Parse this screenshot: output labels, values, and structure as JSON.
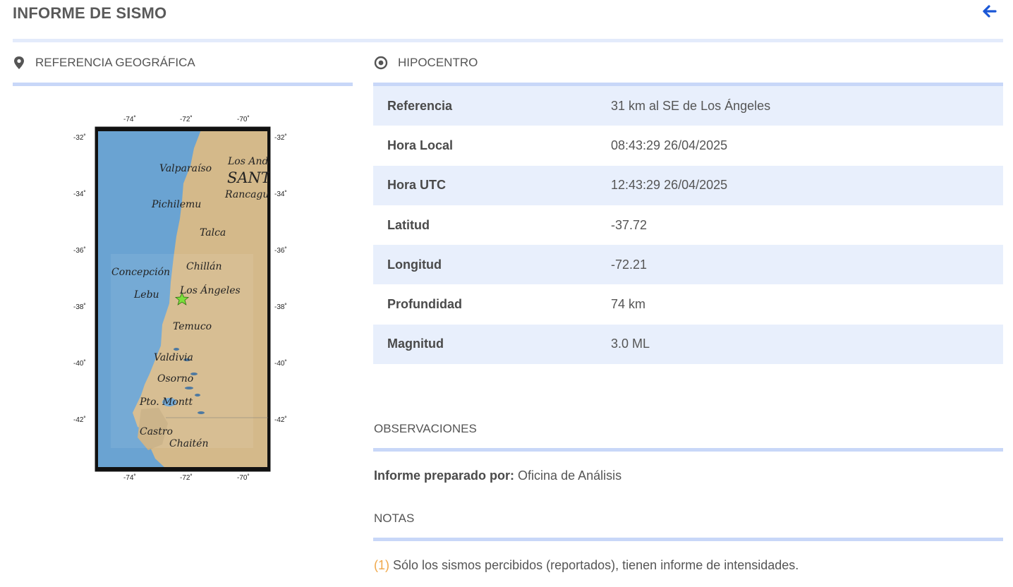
{
  "page": {
    "title": "INFORME DE SISMO",
    "back_icon": "arrow-left-icon",
    "accent_color": "#1a57d6"
  },
  "geo": {
    "heading": "REFERENCIA GEOGRÁFICA",
    "icon": "map-pin-icon",
    "map": {
      "top_ticks": [
        "-74˚",
        "-72˚",
        "-70˚"
      ],
      "bottom_ticks": [
        "-74˚",
        "-72˚",
        "-70˚"
      ],
      "left_ticks": [
        "-32˚",
        "-34˚",
        "-36˚",
        "-38˚",
        "-40˚",
        "-42˚"
      ],
      "right_ticks": [
        "-32˚",
        "-34˚",
        "-36˚",
        "-38˚",
        "-40˚",
        "-42˚"
      ],
      "places": {
        "valparaiso": "Valparaíso",
        "los_andes": "Los Andes",
        "santiago": "SANTIAGO",
        "rancagua": "Rancagua",
        "pichilemu": "Pichilemu",
        "talca": "Talca",
        "concepcion": "Concepción",
        "chillan": "Chillán",
        "lebu": "Lebu",
        "los_angeles": "Los Ángeles",
        "temuco": "Temuco",
        "valdivia": "Valdivia",
        "osorno": "Osorno",
        "pto_montt": "Pto. Montt",
        "castro": "Castro",
        "chaiten": "Chaitén"
      },
      "epicenter_icon": "star-icon"
    }
  },
  "hipo": {
    "heading": "HIPOCENTRO",
    "icon": "target-icon",
    "rows": [
      {
        "key": "Referencia",
        "value": "31 km al SE de Los Ángeles"
      },
      {
        "key": "Hora Local",
        "value": "08:43:29 26/04/2025"
      },
      {
        "key": "Hora UTC",
        "value": "12:43:29 26/04/2025"
      },
      {
        "key": "Latitud",
        "value": "-37.72"
      },
      {
        "key": "Longitud",
        "value": "-72.21"
      },
      {
        "key": "Profundidad",
        "value": "74 km"
      },
      {
        "key": "Magnitud",
        "value": "3.0 ML"
      }
    ]
  },
  "obs": {
    "heading": "OBSERVACIONES",
    "prepared_label": "Informe preparado por:",
    "prepared_value": "Oficina de Análisis"
  },
  "notes": {
    "heading": "NOTAS",
    "items": [
      {
        "num": "(1)",
        "text": "Sólo los sismos percibidos (reportados), tienen informe de intensidades."
      }
    ]
  }
}
